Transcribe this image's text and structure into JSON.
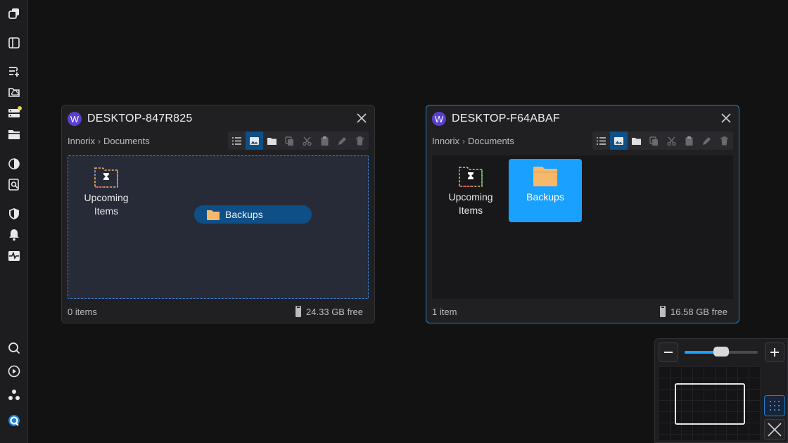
{
  "sidebar": {
    "icons": [
      "app-windows-icon",
      "sidebar-panel-icon",
      "add-list-icon",
      "cloud-folder-icon",
      "server-icon",
      "folder-icon",
      "pie-chart-icon",
      "search-document-icon",
      "shield-icon",
      "bell-icon",
      "activity-monitor-icon",
      "search-icon",
      "play-circle-icon",
      "cluster-icon",
      "sync-circle-icon"
    ],
    "notification_color": "#f4d03f"
  },
  "windows": [
    {
      "avatar_letter": "W",
      "title": "DESKTOP-847R825",
      "breadcrumb": [
        "Innorix",
        "Documents"
      ],
      "items": [
        {
          "label_line1": "Upcoming",
          "label_line2": "Items",
          "icon": "hourglass-folder-icon"
        }
      ],
      "drag_chip": "Backups",
      "status_items": "0 items",
      "status_free": "24.33 GB free"
    },
    {
      "avatar_letter": "W",
      "title": "DESKTOP-F64ABAF",
      "breadcrumb": [
        "Innorix",
        "Documents"
      ],
      "items": [
        {
          "label_line1": "Upcoming",
          "label_line2": "Items",
          "icon": "hourglass-folder-icon"
        },
        {
          "label": "Backups",
          "icon": "folder-icon",
          "selected": true
        }
      ],
      "status_items": "1 item",
      "status_free": "16.58 GB free"
    }
  ],
  "toolbar": [
    "list-view-icon",
    "thumbnail-view-icon",
    "new-folder-icon",
    "copy-icon",
    "cut-icon",
    "paste-icon",
    "rename-icon",
    "delete-icon"
  ],
  "minimap": {
    "zoom_level": 0.5
  },
  "colors": {
    "accent": "#1aa0ff",
    "focus_border": "#1e7fd6",
    "folder": "#f6b86b"
  }
}
